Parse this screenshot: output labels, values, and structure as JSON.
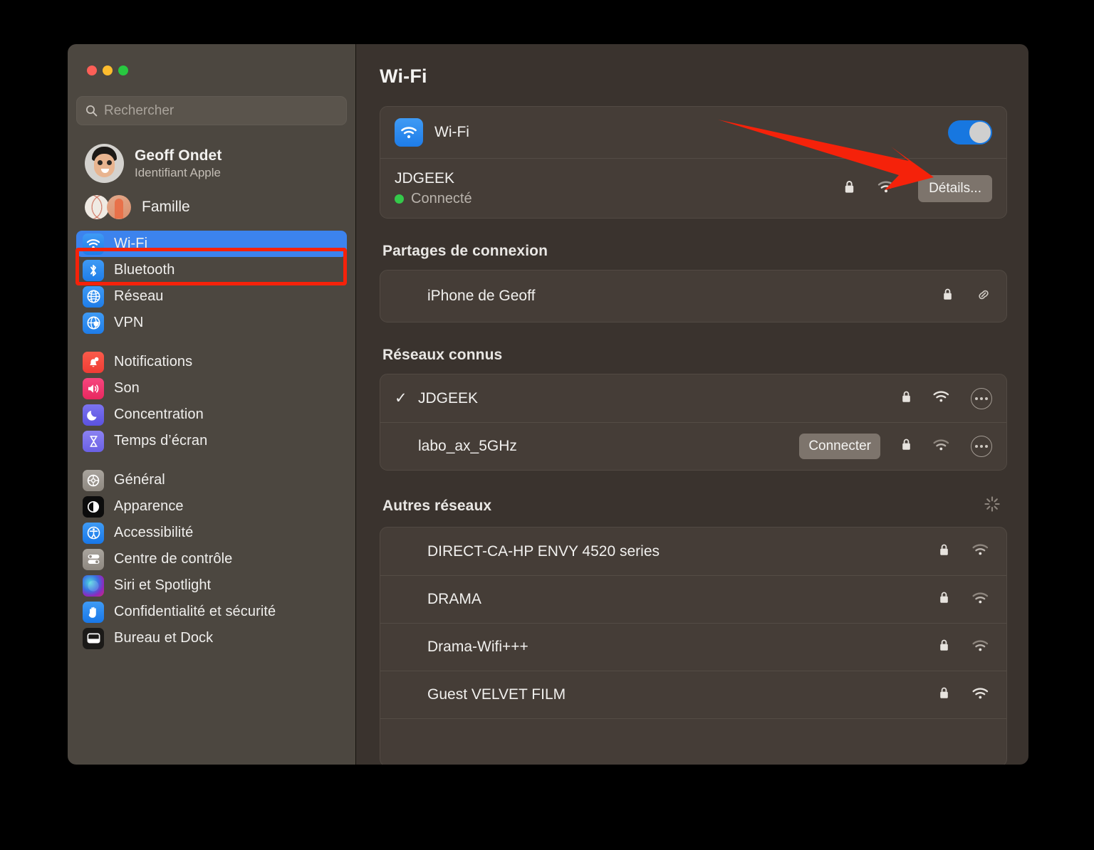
{
  "window": {
    "traffic_lights": [
      "close",
      "minimize",
      "zoom"
    ]
  },
  "search": {
    "placeholder": "Rechercher",
    "value": "",
    "icon": "search-icon"
  },
  "account": {
    "name": "Geoff Ondet",
    "subtitle": "Identifiant Apple",
    "avatar_icon": "memoji-avatar"
  },
  "family": {
    "label": "Famille",
    "avatar_icon": "family-avatars"
  },
  "sidebar": {
    "groups": [
      {
        "items": [
          {
            "label": "Wi-Fi",
            "icon": "wifi-icon",
            "selected": true,
            "highlighted": true
          },
          {
            "label": "Bluetooth",
            "icon": "bluetooth-icon",
            "selected": false
          },
          {
            "label": "Réseau",
            "icon": "globe-icon",
            "selected": false
          },
          {
            "label": "VPN",
            "icon": "vpn-globe-icon",
            "selected": false
          }
        ]
      },
      {
        "items": [
          {
            "label": "Notifications",
            "icon": "bell-icon",
            "selected": false
          },
          {
            "label": "Son",
            "icon": "speaker-icon",
            "selected": false
          },
          {
            "label": "Concentration",
            "icon": "moon-icon",
            "selected": false
          },
          {
            "label": "Temps d’écran",
            "icon": "hourglass-icon",
            "selected": false
          }
        ]
      },
      {
        "items": [
          {
            "label": "Général",
            "icon": "gear-icon",
            "selected": false
          },
          {
            "label": "Apparence",
            "icon": "appearance-icon",
            "selected": false
          },
          {
            "label": "Accessibilité",
            "icon": "accessibility-icon",
            "selected": false
          },
          {
            "label": "Centre de contrôle",
            "icon": "control-center-icon",
            "selected": false
          },
          {
            "label": "Siri et Spotlight",
            "icon": "siri-icon",
            "selected": false
          },
          {
            "label": "Confidentialité et sécurité",
            "icon": "hand-privacy-icon",
            "selected": false
          },
          {
            "label": "Bureau et Dock",
            "icon": "desktop-dock-icon",
            "selected": false
          }
        ]
      }
    ]
  },
  "main": {
    "title": "Wi-Fi",
    "wifi_toggle": {
      "label": "Wi-Fi",
      "on": true,
      "icon": "wifi-icon"
    },
    "connected_network": {
      "name": "JDGEEK",
      "status": "Connecté",
      "status_color": "#34c94a",
      "details_button": "Détails...",
      "lock_icon": "lock-icon",
      "signal_icon": "wifi-signal-icon"
    },
    "sections": [
      {
        "title": "Partages de connexion",
        "rows": [
          {
            "name": "iPhone de Geoff",
            "lock_icon": "lock-icon",
            "trailing_icon": "link-icon"
          }
        ]
      },
      {
        "title": "Réseaux connus",
        "rows": [
          {
            "name": "JDGEEK",
            "checked": true,
            "lock_icon": "lock-icon",
            "signal_icon": "wifi-signal-icon",
            "more_icon": "more-options-icon"
          },
          {
            "name": "labo_ax_5GHz",
            "checked": false,
            "action": "Connecter",
            "lock_icon": "lock-icon",
            "signal_icon": "wifi-signal-weak-icon",
            "more_icon": "more-options-icon"
          }
        ]
      },
      {
        "title": "Autres réseaux",
        "spinner_icon": "loading-spinner-icon",
        "rows": [
          {
            "name": "DIRECT-CA-HP ENVY 4520 series",
            "lock_icon": "lock-icon",
            "signal_icon": "wifi-signal-weak-icon"
          },
          {
            "name": "DRAMA",
            "lock_icon": "lock-icon",
            "signal_icon": "wifi-signal-weak-icon"
          },
          {
            "name": "Drama-Wifi+++",
            "lock_icon": "lock-icon",
            "signal_icon": "wifi-signal-weak-icon"
          },
          {
            "name": "Guest VELVET FILM",
            "lock_icon": "lock-icon",
            "signal_icon": "wifi-signal-icon"
          },
          {
            "name": "",
            "lock_icon": "",
            "signal_icon": ""
          }
        ]
      }
    ]
  },
  "annotations": {
    "arrow_color": "#f5220a",
    "highlight_color": "#f5220a",
    "arrow_target": "details-button",
    "highlight_target": "sidebar-item-wi-fi"
  }
}
